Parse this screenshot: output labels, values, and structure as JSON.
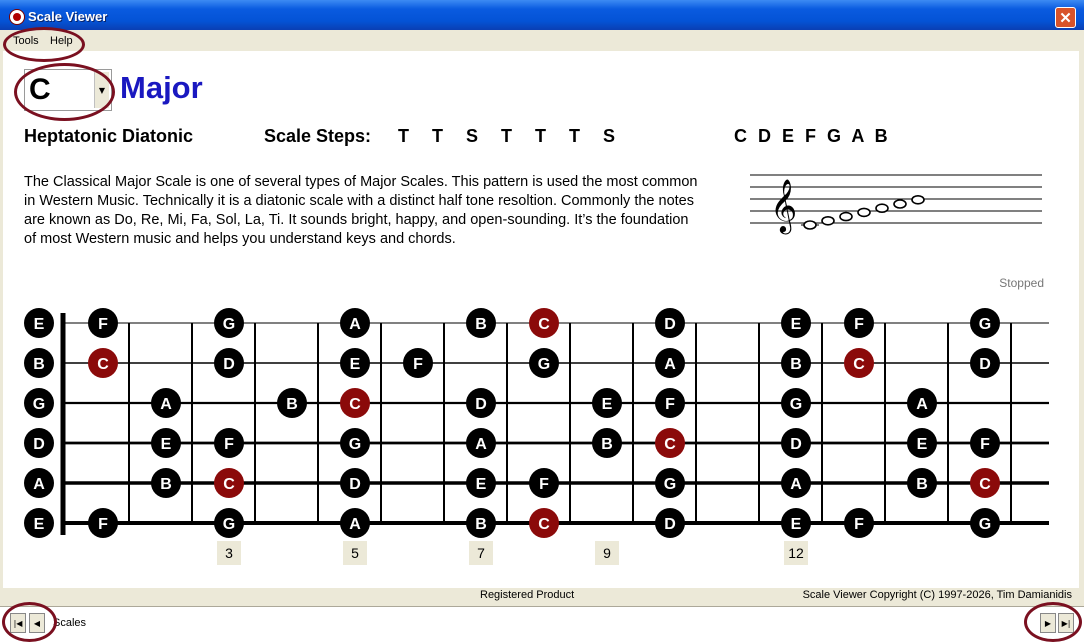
{
  "window": {
    "title": "Scale Viewer",
    "close_glyph": "✕"
  },
  "menu": {
    "items": [
      "Tools",
      "Help"
    ]
  },
  "scale": {
    "key": "C",
    "name": "Major",
    "type": "Heptatonic Diatonic",
    "steps_label": "Scale Steps:",
    "steps": "T T S T T T S",
    "notes": "C D E F G A B",
    "description": "The Classical Major Scale is one of several types of Major Scales. This pattern is used the most common in Western Music. Technically it is a diatonic scale with a distinct half tone resoltion. Commonly the notes are known as Do, Re, Mi, Fa, Sol, La, Ti. It sounds bright, happy, and open-sounding. It’s the foundation of most Western music and helps you understand keys and chords.",
    "staff_clef": "𝄞"
  },
  "status": "Stopped",
  "fretboard": {
    "open_strings": [
      "E",
      "B",
      "G",
      "D",
      "A",
      "E"
    ],
    "fret_markers": [
      "3",
      "5",
      "7",
      "9",
      "12"
    ],
    "fret_marker_positions": [
      3,
      5,
      7,
      9,
      12
    ],
    "root_note": "C",
    "notes": [
      [
        "F",
        "",
        "G",
        "",
        "A",
        "",
        "B",
        "C",
        "",
        "D",
        "",
        "E",
        "F",
        "",
        "G"
      ],
      [
        "C",
        "",
        "D",
        "",
        "E",
        "F",
        "",
        "G",
        "",
        "A",
        "",
        "B",
        "C",
        "",
        "D"
      ],
      [
        "",
        "A",
        "",
        "B",
        "C",
        "",
        "D",
        "",
        "E",
        "F",
        "",
        "G",
        "",
        "A",
        ""
      ],
      [
        "",
        "E",
        "F",
        "",
        "G",
        "",
        "A",
        "",
        "B",
        "C",
        "",
        "D",
        "",
        "E",
        "F"
      ],
      [
        "",
        "B",
        "C",
        "",
        "D",
        "",
        "E",
        "F",
        "",
        "G",
        "",
        "A",
        "",
        "B",
        "C"
      ],
      [
        "F",
        "",
        "G",
        "",
        "A",
        "",
        "B",
        "C",
        "",
        "D",
        "",
        "E",
        "F",
        "",
        "G"
      ]
    ],
    "colors": {
      "note": "#000000",
      "root": "#8b0a0a",
      "marker_bg": "#ece9d8"
    }
  },
  "footer": {
    "registered": "Registered Product",
    "copyright": "Scale Viewer Copyright (C) 1997-2026, Tim Damianidis"
  },
  "navbar": {
    "first_glyph": "|◀",
    "prev_glyph": "◀",
    "text": "Scales",
    "next_glyph": "▶",
    "last_glyph": "▶|"
  },
  "colors": {
    "scale_name": "#1a18c0",
    "highlight_ring": "#7a1020"
  }
}
